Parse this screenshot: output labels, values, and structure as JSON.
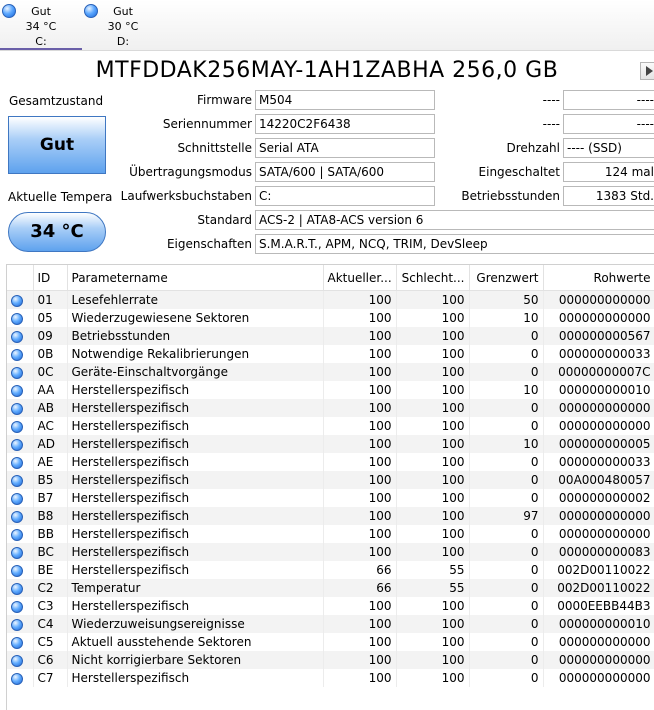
{
  "drives": [
    {
      "status": "Gut",
      "temp": "34 °C",
      "letter": "C:"
    },
    {
      "status": "Gut",
      "temp": "30 °C",
      "letter": "D:"
    }
  ],
  "model_title": "MTFDDAK256MAY-1AH1ZABHA 256,0 GB",
  "health": {
    "label": "Gesamtzustand",
    "value": "Gut"
  },
  "temperature": {
    "label": "Aktuelle Temperatur",
    "value": "34 °C"
  },
  "info": {
    "firmware": {
      "label": "Firmware",
      "value": "M504"
    },
    "serial": {
      "label": "Seriennummer",
      "value": "14220C2F6438"
    },
    "interface": {
      "label": "Schnittstelle",
      "value": "Serial ATA"
    },
    "transfer": {
      "label": "Übertragungsmodus",
      "value": "SATA/600 | SATA/600"
    },
    "letters": {
      "label": "Laufwerksbuchstaben",
      "value": "C:"
    },
    "standard": {
      "label": "Standard",
      "value": "ACS-2 | ATA8-ACS version 6"
    },
    "features": {
      "label": "Eigenschaften",
      "value": "S.M.A.R.T., APM, NCQ, TRIM, DevSleep"
    }
  },
  "right_info": {
    "r1": {
      "label": "----",
      "value": "----"
    },
    "r2": {
      "label": "----",
      "value": "----"
    },
    "rotation": {
      "label": "Drehzahl",
      "value": "---- (SSD)"
    },
    "power_on_count": {
      "label": "Eingeschaltet",
      "value": "124 mal"
    },
    "power_on_hours": {
      "label": "Betriebsstunden",
      "value": "1383 Std."
    }
  },
  "table": {
    "headers": [
      "ID",
      "Parametername",
      "Aktueller...",
      "Schlecht...",
      "Grenzwert",
      "Rohwerte"
    ],
    "rows": [
      {
        "id": "01",
        "name": "Lesefehlerrate",
        "cur": "100",
        "worst": "100",
        "thr": "50",
        "raw": "000000000000"
      },
      {
        "id": "05",
        "name": "Wiederzugewiesene Sektoren",
        "cur": "100",
        "worst": "100",
        "thr": "10",
        "raw": "000000000000"
      },
      {
        "id": "09",
        "name": "Betriebsstunden",
        "cur": "100",
        "worst": "100",
        "thr": "0",
        "raw": "000000000567"
      },
      {
        "id": "0B",
        "name": "Notwendige Rekalibrierungen",
        "cur": "100",
        "worst": "100",
        "thr": "0",
        "raw": "000000000033"
      },
      {
        "id": "0C",
        "name": "Geräte-Einschaltvorgänge",
        "cur": "100",
        "worst": "100",
        "thr": "0",
        "raw": "00000000007C"
      },
      {
        "id": "AA",
        "name": "Herstellerspezifisch",
        "cur": "100",
        "worst": "100",
        "thr": "10",
        "raw": "000000000010"
      },
      {
        "id": "AB",
        "name": "Herstellerspezifisch",
        "cur": "100",
        "worst": "100",
        "thr": "0",
        "raw": "000000000000"
      },
      {
        "id": "AC",
        "name": "Herstellerspezifisch",
        "cur": "100",
        "worst": "100",
        "thr": "0",
        "raw": "000000000000"
      },
      {
        "id": "AD",
        "name": "Herstellerspezifisch",
        "cur": "100",
        "worst": "100",
        "thr": "10",
        "raw": "000000000005"
      },
      {
        "id": "AE",
        "name": "Herstellerspezifisch",
        "cur": "100",
        "worst": "100",
        "thr": "0",
        "raw": "000000000033"
      },
      {
        "id": "B5",
        "name": "Herstellerspezifisch",
        "cur": "100",
        "worst": "100",
        "thr": "0",
        "raw": "00A000480057"
      },
      {
        "id": "B7",
        "name": "Herstellerspezifisch",
        "cur": "100",
        "worst": "100",
        "thr": "0",
        "raw": "000000000002"
      },
      {
        "id": "B8",
        "name": "Herstellerspezifisch",
        "cur": "100",
        "worst": "100",
        "thr": "97",
        "raw": "000000000000"
      },
      {
        "id": "BB",
        "name": "Herstellerspezifisch",
        "cur": "100",
        "worst": "100",
        "thr": "0",
        "raw": "000000000000"
      },
      {
        "id": "BC",
        "name": "Herstellerspezifisch",
        "cur": "100",
        "worst": "100",
        "thr": "0",
        "raw": "000000000083"
      },
      {
        "id": "BE",
        "name": "Herstellerspezifisch",
        "cur": "66",
        "worst": "55",
        "thr": "0",
        "raw": "002D00110022"
      },
      {
        "id": "C2",
        "name": "Temperatur",
        "cur": "66",
        "worst": "55",
        "thr": "0",
        "raw": "002D00110022"
      },
      {
        "id": "C3",
        "name": "Herstellerspezifisch",
        "cur": "100",
        "worst": "100",
        "thr": "0",
        "raw": "0000EEBB44B3"
      },
      {
        "id": "C4",
        "name": "Wiederzuweisungsereignisse",
        "cur": "100",
        "worst": "100",
        "thr": "0",
        "raw": "000000000010"
      },
      {
        "id": "C5",
        "name": "Aktuell ausstehende Sektoren",
        "cur": "100",
        "worst": "100",
        "thr": "0",
        "raw": "000000000000"
      },
      {
        "id": "C6",
        "name": "Nicht korrigierbare Sektoren",
        "cur": "100",
        "worst": "100",
        "thr": "0",
        "raw": "000000000000"
      },
      {
        "id": "C7",
        "name": "Herstellerspezifisch",
        "cur": "100",
        "worst": "100",
        "thr": "0",
        "raw": "000000000000"
      }
    ]
  },
  "icons": {
    "status_dot": "status-good-icon",
    "next": "next-arrow-icon"
  }
}
